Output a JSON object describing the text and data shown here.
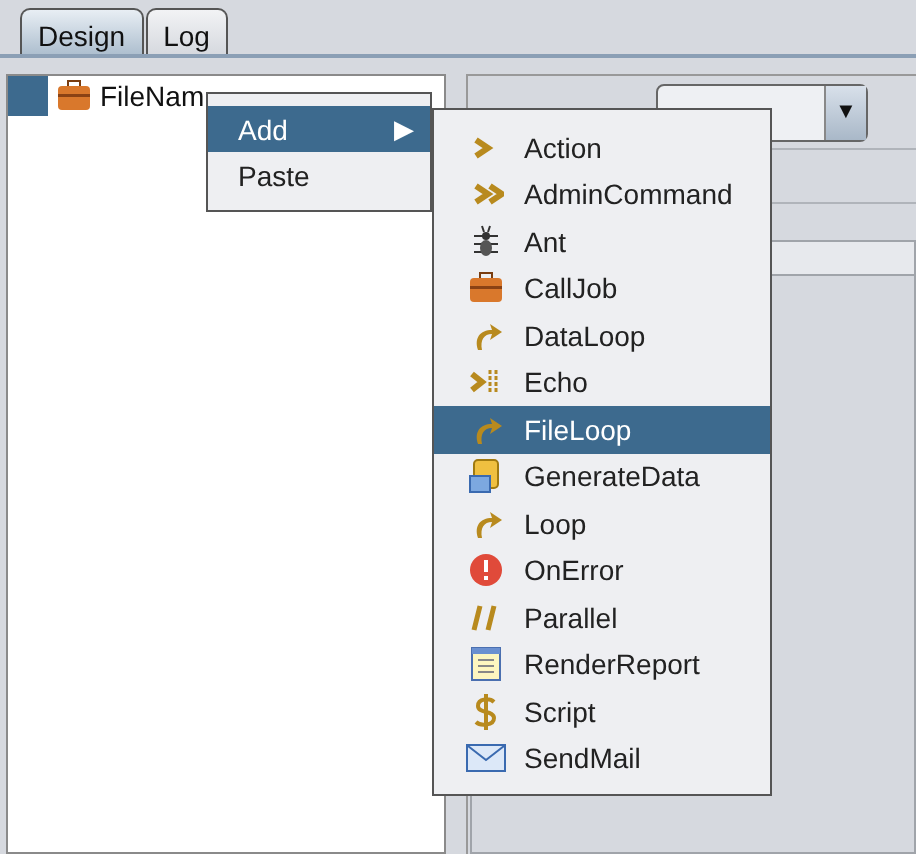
{
  "tabs": [
    {
      "label": "Design",
      "selected": true
    },
    {
      "label": "Log",
      "selected": false
    }
  ],
  "tree": {
    "label": "FileNam",
    "selected": true
  },
  "context_menu": [
    {
      "label": "Add",
      "selected": true,
      "arrow": "▶"
    },
    {
      "label": "Paste",
      "selected": false
    }
  ],
  "submenu": [
    {
      "label": "Action",
      "selected": false
    },
    {
      "label": "AdminCommand",
      "selected": false
    },
    {
      "label": "Ant",
      "selected": false
    },
    {
      "label": "CallJob",
      "selected": false
    },
    {
      "label": "DataLoop",
      "selected": false
    },
    {
      "label": "Echo",
      "selected": false
    },
    {
      "label": "FileLoop",
      "selected": true
    },
    {
      "label": "GenerateData",
      "selected": false
    },
    {
      "label": "Loop",
      "selected": false
    },
    {
      "label": "OnError",
      "selected": false
    },
    {
      "label": "Parallel",
      "selected": false
    },
    {
      "label": "RenderReport",
      "selected": false
    },
    {
      "label": "Script",
      "selected": false
    },
    {
      "label": "SendMail",
      "selected": false
    }
  ],
  "combo": {
    "arrow": "▼"
  }
}
